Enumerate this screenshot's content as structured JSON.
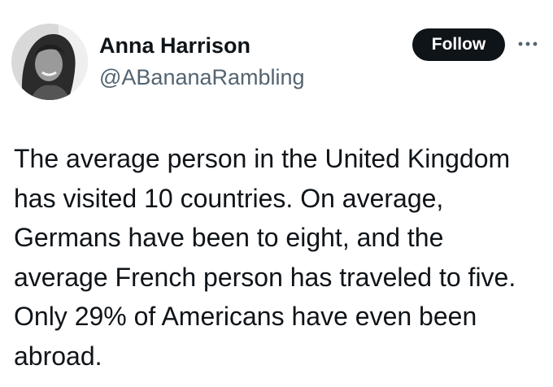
{
  "author": {
    "name": "Anna Harrison",
    "handle": "@ABananaRambling"
  },
  "actions": {
    "follow_label": "Follow",
    "more_icon": "more-horizontal-icon"
  },
  "tweet": {
    "text": "The average person in the United Kingdom has visited 10 countries. On average, Germans have been to eight, and the average French person has traveled to five. Only 29% of Americans have even been abroad."
  },
  "colors": {
    "text_primary": "#0f1419",
    "text_secondary": "#536471",
    "button_bg": "#0f1419",
    "button_text": "#ffffff"
  }
}
